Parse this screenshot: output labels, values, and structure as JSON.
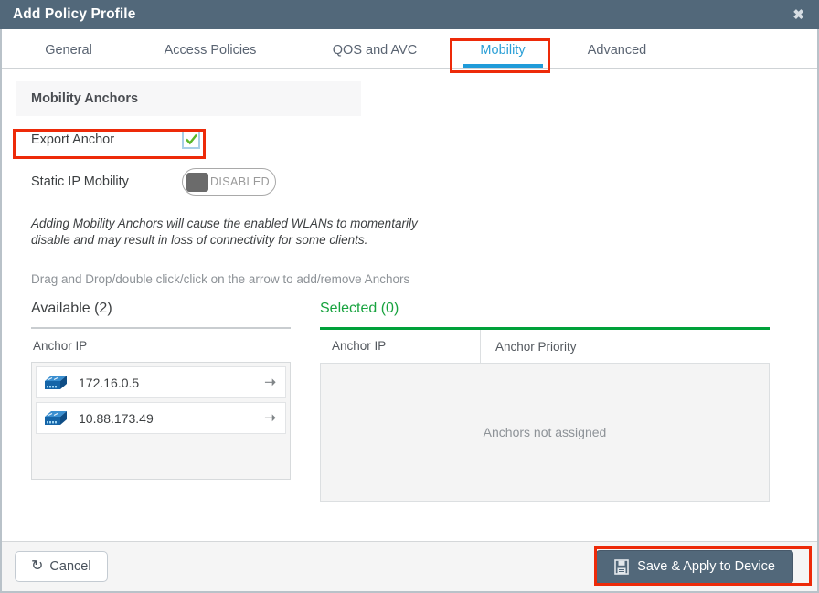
{
  "window": {
    "title": "Add Policy Profile",
    "close_icon": "close-icon"
  },
  "tabs": [
    {
      "label": "General",
      "active": false
    },
    {
      "label": "Access Policies",
      "active": false
    },
    {
      "label": "QOS and AVC",
      "active": false
    },
    {
      "label": "Mobility",
      "active": true
    },
    {
      "label": "Advanced",
      "active": false
    }
  ],
  "section": {
    "heading": "Mobility Anchors"
  },
  "fields": {
    "export_anchor": {
      "label": "Export Anchor",
      "checked": true,
      "check_icon": "check-icon"
    },
    "static_ip_mobility": {
      "label": "Static IP Mobility",
      "state_label": "DISABLED",
      "enabled": false
    }
  },
  "messages": {
    "warning_line1": "Adding Mobility Anchors will cause the enabled WLANs to momentarily",
    "warning_line2": "disable and may result in loss of connectivity for some clients.",
    "hint": "Drag and Drop/double click/click on the arrow to add/remove Anchors"
  },
  "available": {
    "title": "Available (2)",
    "column_header": "Anchor IP",
    "items": [
      {
        "ip": "172.16.0.5",
        "device_icon": "network-switch-icon",
        "arrow_icon": "arrow-right-icon"
      },
      {
        "ip": "10.88.173.49",
        "device_icon": "network-switch-icon",
        "arrow_icon": "arrow-right-icon"
      }
    ]
  },
  "selected": {
    "title": "Selected (0)",
    "column_header_ip": "Anchor IP",
    "column_header_priority": "Anchor Priority",
    "empty_text": "Anchors not assigned"
  },
  "footer": {
    "cancel_label": "Cancel",
    "cancel_icon": "undo-arrow-icon",
    "save_label": "Save & Apply to Device",
    "save_icon": "floppy-disk-icon"
  },
  "colors": {
    "titlebar": "#52687a",
    "accent_blue": "#1f9bd9",
    "accent_green": "#00a13a",
    "annotation_red": "#ed2a09",
    "check_green": "#5cb82b"
  },
  "annotations": [
    {
      "target": "mobility-tab"
    },
    {
      "target": "export-anchor-row"
    },
    {
      "target": "save-apply-button"
    }
  ]
}
